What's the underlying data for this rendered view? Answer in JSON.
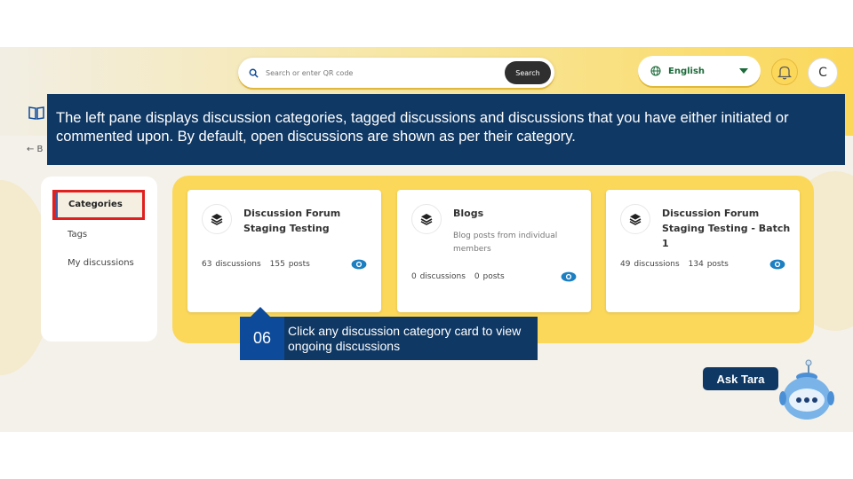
{
  "header": {
    "search_placeholder": "Search or enter QR code",
    "search_button": "Search",
    "language": "English",
    "avatar_initial": "C"
  },
  "back_link": "← B",
  "sidebar": {
    "items": [
      {
        "label": "Categories",
        "active": true
      },
      {
        "label": "Tags",
        "active": false
      },
      {
        "label": "My discussions",
        "active": false
      }
    ]
  },
  "cards": [
    {
      "title": "Discussion Forum Staging Testing",
      "description": "",
      "discussions": "63 discussions",
      "posts": "155 posts"
    },
    {
      "title": "Blogs",
      "description": "Blog posts from individual members",
      "discussions": "0 discussions",
      "posts": "0 posts"
    },
    {
      "title": "Discussion Forum Staging Testing - Batch 1",
      "description": "",
      "discussions": "49 discussions",
      "posts": "134 posts"
    }
  ],
  "tutorial": {
    "banner": "The left pane displays discussion categories, tagged discussions and discussions that you have either initiated or commented upon. By default, open discussions are shown as per their category.",
    "step_number": "06",
    "step_text": "Click any discussion category card to view ongoing discussions"
  },
  "assistant": {
    "label": "Ask Tara"
  },
  "colors": {
    "brand_yellow": "#fbd85a",
    "tutorial_navy": "#0f3864",
    "step_blue": "#0d4b9a",
    "highlight_red": "#e01f1f",
    "eye_blue": "#1b7fc1",
    "language_green": "#1b6b3a"
  }
}
